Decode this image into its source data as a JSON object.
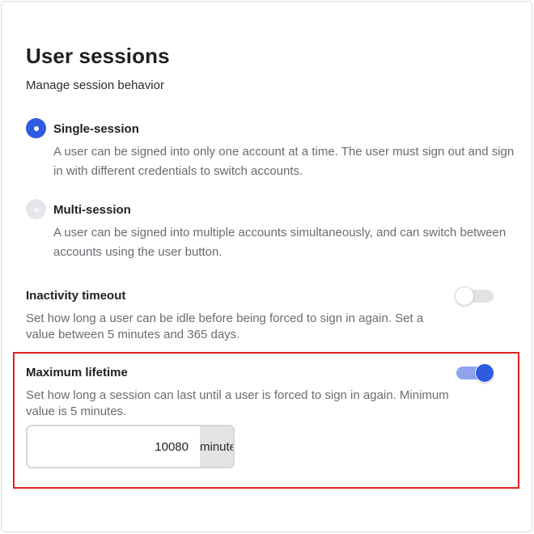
{
  "page": {
    "title": "User sessions",
    "subtitle": "Manage session behavior"
  },
  "session_mode": {
    "selected": "single",
    "options": [
      {
        "label": "Single-session",
        "description": "A user can be signed into only one account at a time. The user must sign out and sign in with different credentials to switch accounts.",
        "checked": true
      },
      {
        "label": "Multi-session",
        "description": "A user can be signed into multiple accounts simultaneously, and can switch between accounts using the user button.",
        "checked": false
      }
    ]
  },
  "inactivity_timeout": {
    "label": "Inactivity timeout",
    "description": "Set how long a user can be idle before being forced to sign in again. Set a value between 5 minutes and 365 days.",
    "enabled": false
  },
  "maximum_lifetime": {
    "label": "Maximum lifetime",
    "description": "Set how long a session can last until a user is forced to sign in again. Minimum value is 5 minutes.",
    "enabled": true,
    "value": "10080",
    "unit": "minutes"
  },
  "colors": {
    "accent": "#2f5be0",
    "toggle_track_on": "#8ea3ec",
    "highlight_border": "#e0201e"
  }
}
